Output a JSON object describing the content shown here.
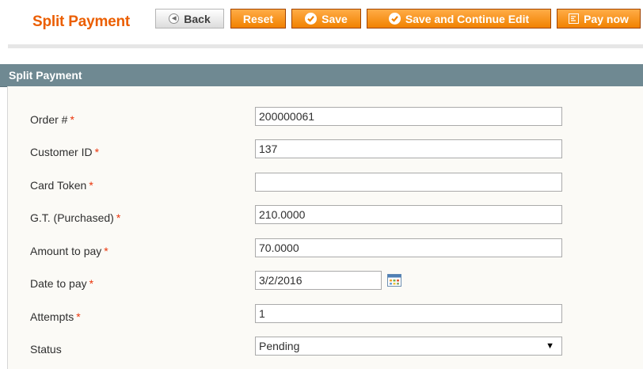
{
  "header": {
    "title": "Split Payment",
    "buttons": {
      "back": "Back",
      "reset": "Reset",
      "save": "Save",
      "save_continue": "Save and Continue Edit",
      "pay_now": "Pay now"
    }
  },
  "section": {
    "title": "Split Payment"
  },
  "form": {
    "required_mark": "*",
    "order_number": {
      "label": "Order #",
      "value": "200000061"
    },
    "customer_id": {
      "label": "Customer ID",
      "value": "137"
    },
    "card_token": {
      "label": "Card Token",
      "value": ""
    },
    "gt_purchased": {
      "label": "G.T. (Purchased)",
      "value": "210.0000"
    },
    "amount_to_pay": {
      "label": "Amount to pay",
      "value": "70.0000"
    },
    "date_to_pay": {
      "label": "Date to pay",
      "value": "3/2/2016"
    },
    "attempts": {
      "label": "Attempts",
      "value": "1"
    },
    "status": {
      "label": "Status",
      "value": "Pending"
    }
  },
  "colors": {
    "brand_orange": "#eb5e00",
    "section_header": "#6f8992",
    "required": "#eb340a"
  },
  "icons": {
    "back": "circle-arrow-left-icon",
    "save": "check-circle-icon",
    "pay_now": "pay-icon",
    "date_picker": "calendar-icon",
    "status_select": "triangle-down-icon"
  }
}
